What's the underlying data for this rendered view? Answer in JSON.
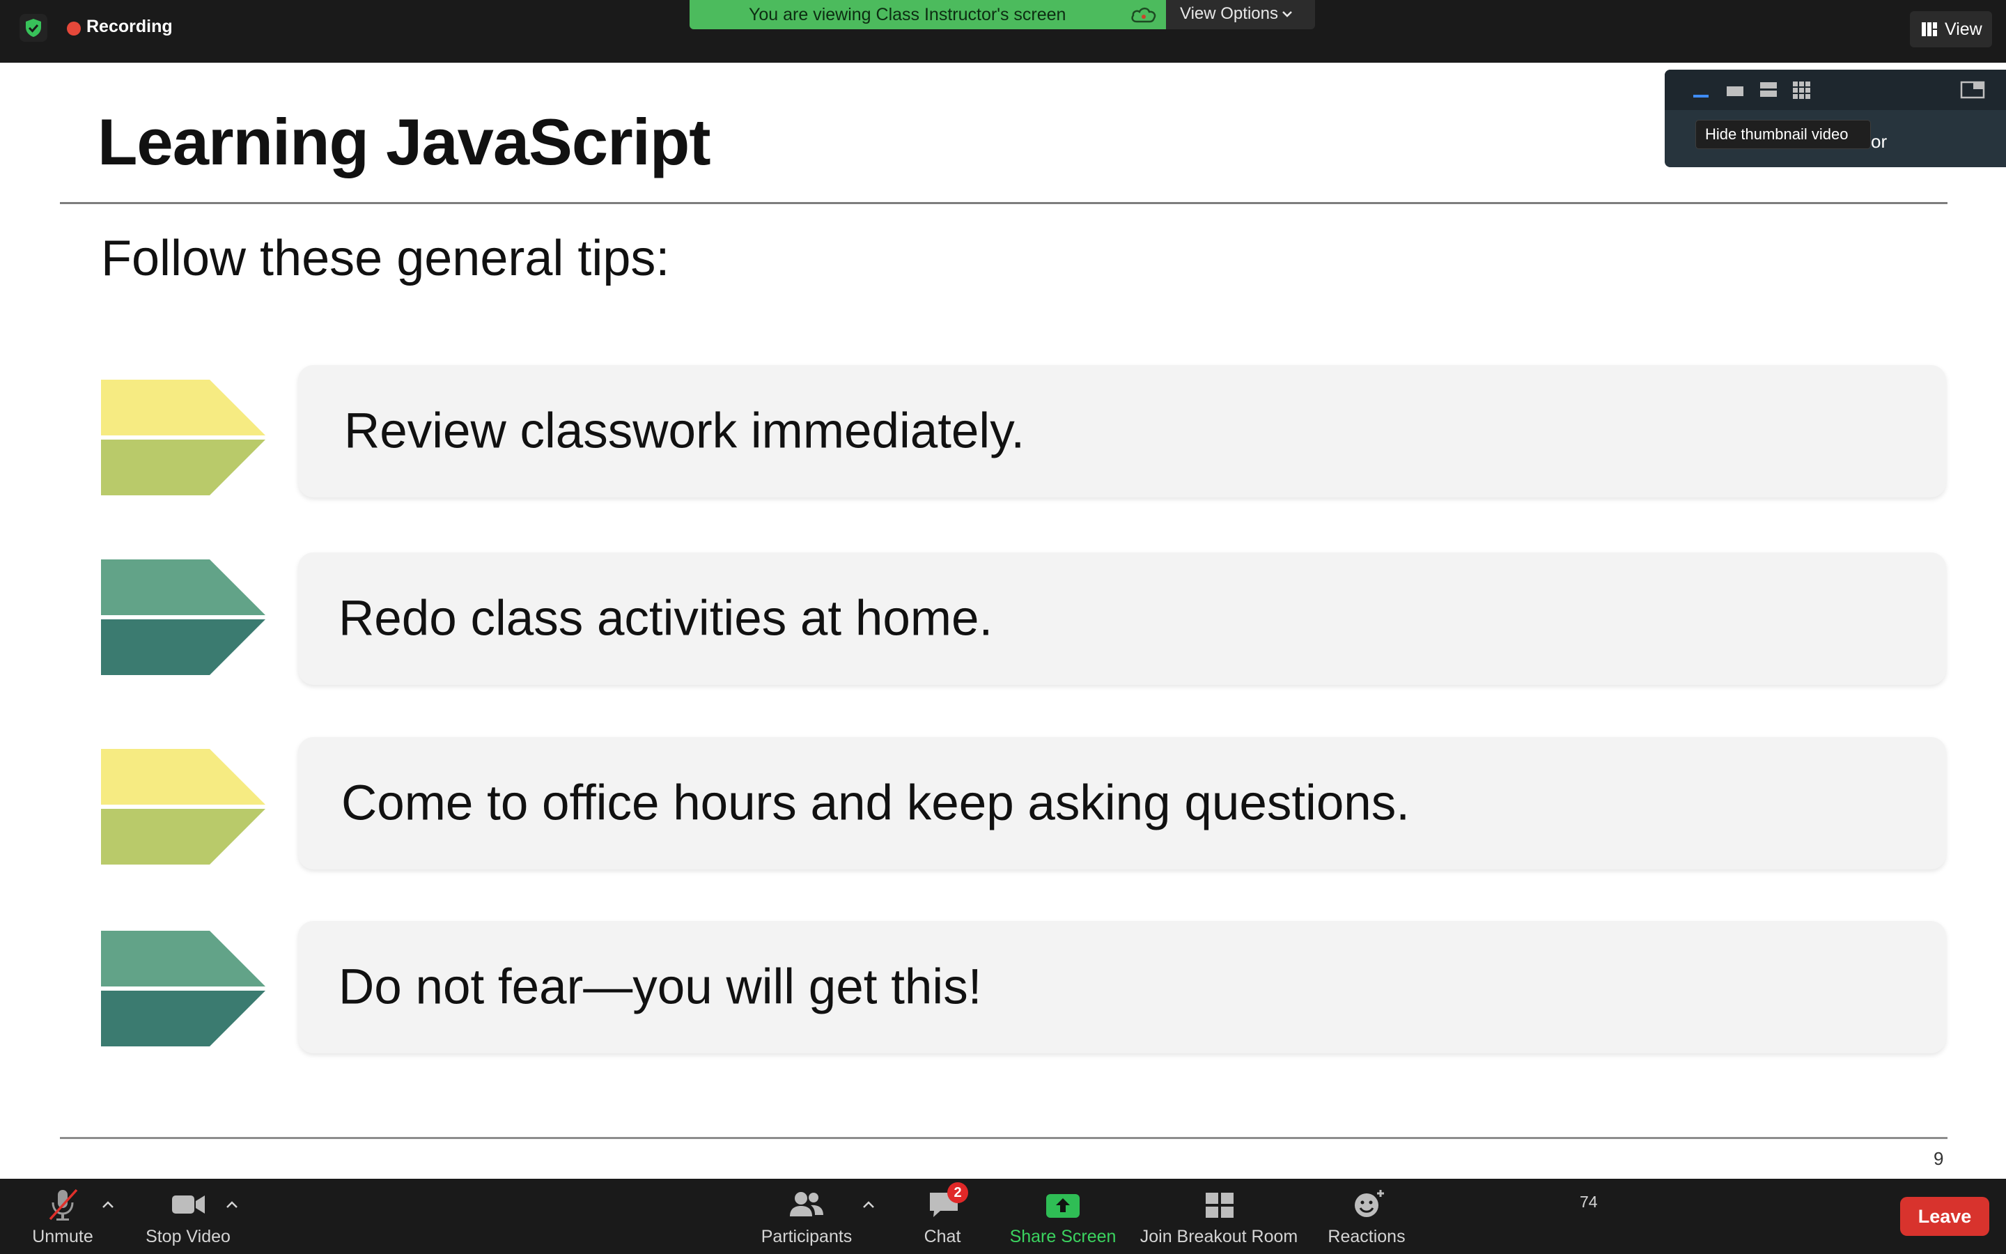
{
  "top_bar": {
    "recording_label": "Recording",
    "banner_text": "You are viewing Class Instructor's screen",
    "view_options_label": "View Options",
    "view_button_label": "View"
  },
  "slide": {
    "title": "Learning JavaScript",
    "subtitle": "Follow these general tips:",
    "tips": [
      {
        "text": "Review classwork immediately.",
        "colors": [
          "#f6eb82",
          "#b9ca6a"
        ]
      },
      {
        "text": "Redo class activities at home.",
        "colors": [
          "#62a388",
          "#3b7b70"
        ]
      },
      {
        "text": "Come to office hours and keep asking questions.",
        "colors": [
          "#f6eb82",
          "#b9ca6a"
        ]
      },
      {
        "text": "Do not fear—you will get this!",
        "colors": [
          "#62a388",
          "#3b7b70"
        ]
      }
    ],
    "page_number": "9"
  },
  "thumbnail": {
    "name_fragment": "or",
    "tooltip": "Hide thumbnail video",
    "active_color": "#3f8cf5"
  },
  "toolbar": {
    "unmute_label": "Unmute",
    "stop_video_label": "Stop Video",
    "participants_label": "Participants",
    "participants_count": "74",
    "chat_label": "Chat",
    "chat_badge": "2",
    "share_screen_label": "Share Screen",
    "share_screen_color": "#2fbd55",
    "breakout_label": "Join Breakout Room",
    "reactions_label": "Reactions",
    "leave_label": "Leave",
    "leave_color": "#d8332d"
  }
}
